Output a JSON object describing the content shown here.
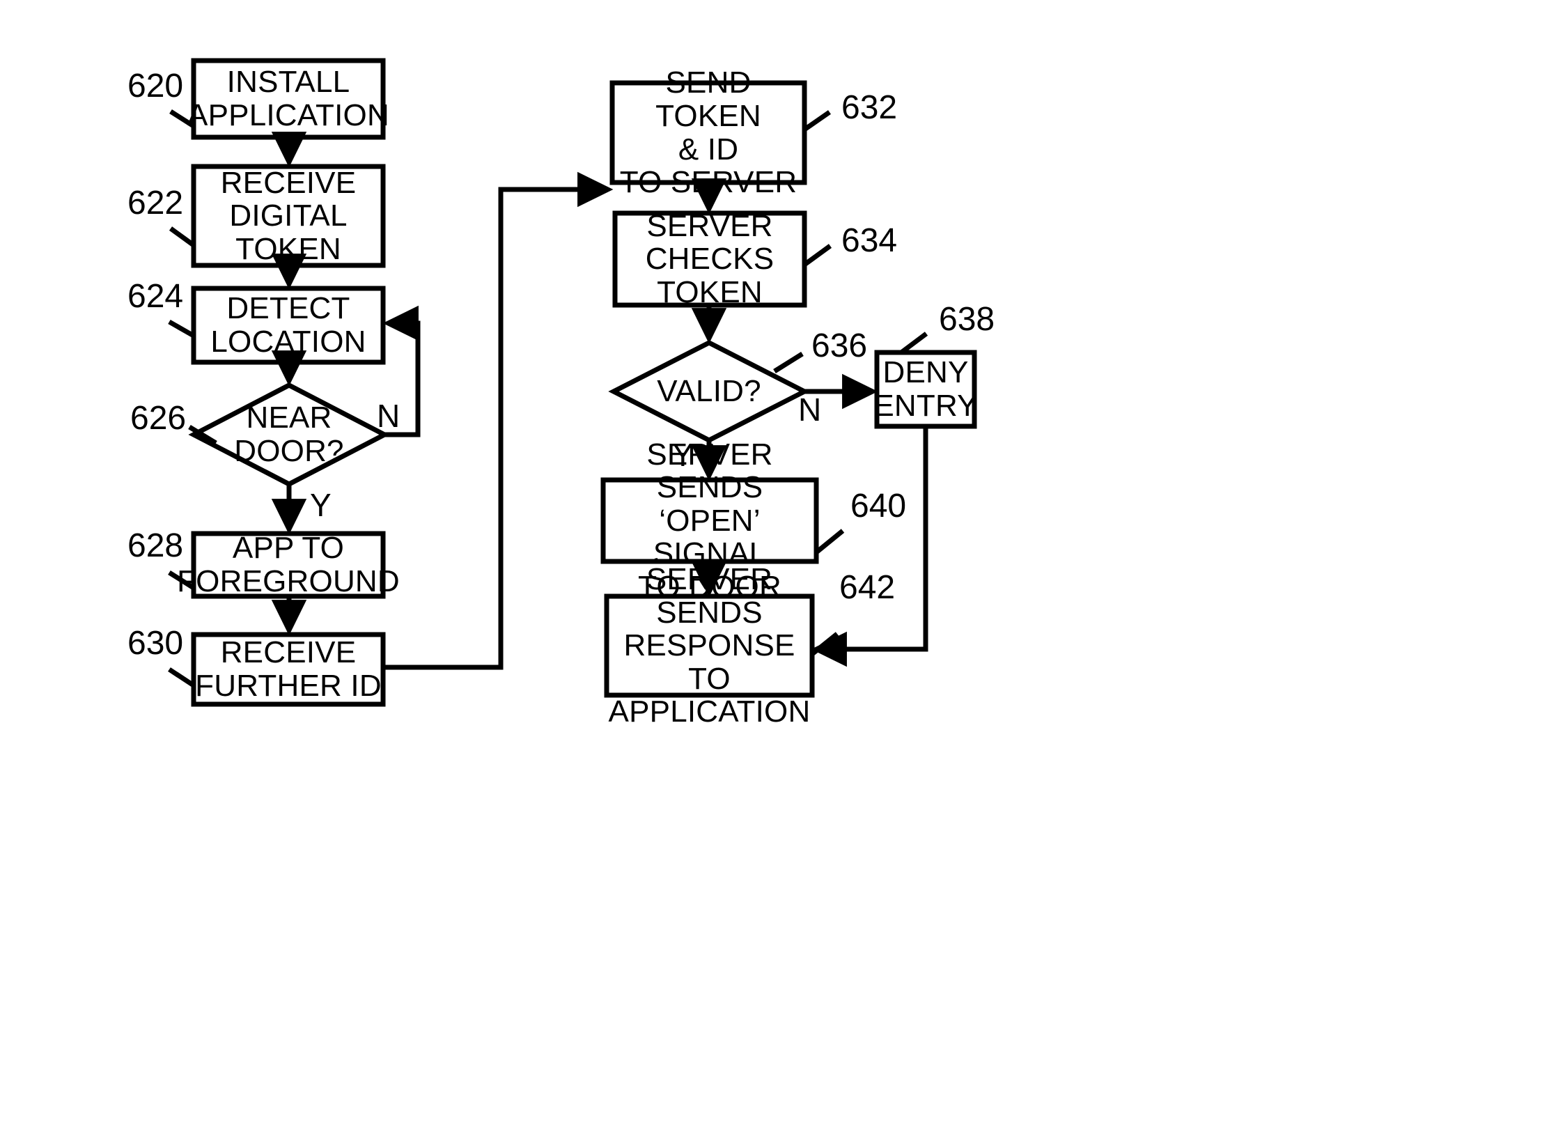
{
  "figure": {
    "type": "flowchart",
    "description": "Patent-style flowchart for mobile application door access using digital token validation"
  },
  "nodes": [
    {
      "id": "620",
      "ref": "620",
      "shape": "process",
      "text": "INSTALL\nAPPLICATION",
      "column": "left"
    },
    {
      "id": "622",
      "ref": "622",
      "shape": "process",
      "text": "RECEIVE\nDIGITAL\nTOKEN",
      "column": "left"
    },
    {
      "id": "624",
      "ref": "624",
      "shape": "process",
      "text": "DETECT\nLOCATION",
      "column": "left"
    },
    {
      "id": "626",
      "ref": "626",
      "shape": "decision",
      "text": "NEAR\nDOOR?",
      "column": "left"
    },
    {
      "id": "628",
      "ref": "628",
      "shape": "process",
      "text": "APP TO\nFOREGROUND",
      "column": "left"
    },
    {
      "id": "630",
      "ref": "630",
      "shape": "process",
      "text": "RECEIVE\nFURTHER ID",
      "column": "left"
    },
    {
      "id": "632",
      "ref": "632",
      "shape": "process",
      "text": "SEND TOKEN\n& ID\nTO SERVER",
      "column": "right"
    },
    {
      "id": "634",
      "ref": "634",
      "shape": "process",
      "text": "SERVER\nCHECKS\nTOKEN",
      "column": "right"
    },
    {
      "id": "636",
      "ref": "636",
      "shape": "decision",
      "text": "VALID?",
      "column": "right"
    },
    {
      "id": "638",
      "ref": "638",
      "shape": "process",
      "text": "DENY\nENTRY",
      "column": "right"
    },
    {
      "id": "640",
      "ref": "640",
      "shape": "process",
      "text": "SERVER SENDS\n‘OPEN’ SIGNAL\nTO DOOR",
      "column": "right"
    },
    {
      "id": "642",
      "ref": "642",
      "shape": "process",
      "text": "SERVER SENDS\nRESPONSE TO\nAPPLICATION",
      "column": "right"
    }
  ],
  "branch_labels": {
    "near_door_no": "N",
    "near_door_yes": "Y",
    "valid_no": "N",
    "valid_yes": "Y"
  },
  "edges": [
    {
      "from": "620",
      "to": "622",
      "label": ""
    },
    {
      "from": "622",
      "to": "624",
      "label": ""
    },
    {
      "from": "624",
      "to": "626",
      "label": ""
    },
    {
      "from": "626",
      "to": "624",
      "label": "N"
    },
    {
      "from": "626",
      "to": "628",
      "label": "Y"
    },
    {
      "from": "628",
      "to": "630",
      "label": ""
    },
    {
      "from": "630",
      "to": "632",
      "label": ""
    },
    {
      "from": "632",
      "to": "634",
      "label": ""
    },
    {
      "from": "634",
      "to": "636",
      "label": ""
    },
    {
      "from": "636",
      "to": "638",
      "label": "N"
    },
    {
      "from": "636",
      "to": "640",
      "label": "Y"
    },
    {
      "from": "640",
      "to": "642",
      "label": ""
    },
    {
      "from": "638",
      "to": "642",
      "label": ""
    }
  ],
  "style": {
    "stroke_color": "#000000",
    "fill_color": "#ffffff",
    "background": "#ffffff"
  }
}
